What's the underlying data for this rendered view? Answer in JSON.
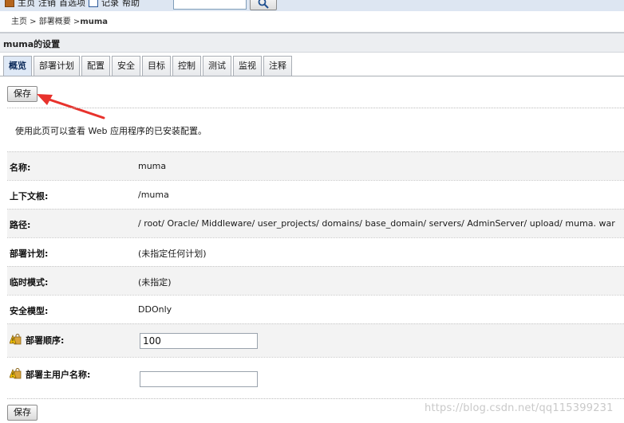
{
  "toolbar": {
    "home": "主页",
    "logout": "注销",
    "preferences": "首选项",
    "record": "记录",
    "help": "帮助",
    "search_value": ""
  },
  "breadcrumb": {
    "home": "主页 >",
    "deployments": "部署概要 >",
    "current": "muma"
  },
  "page": {
    "title": "muma的设置",
    "tabs": [
      "概览",
      "部署计划",
      "配置",
      "安全",
      "目标",
      "控制",
      "测试",
      "监视",
      "注释"
    ],
    "active_tab": 0,
    "save_label": "保存",
    "intro": "使用此页可以查看 Web 应用程序的已安装配置。"
  },
  "settings": [
    {
      "label": "名称:",
      "value": "muma"
    },
    {
      "label": "上下文根:",
      "value": "/muma"
    },
    {
      "label": "路径:",
      "value": "/ root/ Oracle/ Middleware/ user_projects/ domains/ base_domain/ servers/ AdminServer/ upload/ muma. war"
    },
    {
      "label": "部署计划:",
      "value": "(未指定任何计划)"
    },
    {
      "label": "临时模式:",
      "value": "(未指定)"
    },
    {
      "label": "安全模型:",
      "value": "DDOnly"
    },
    {
      "label": "部署顺序:",
      "value": "100"
    },
    {
      "label": "部署主用户名称:",
      "value": ""
    }
  ],
  "watermark": "https://blog.csdn.net/qq115399231",
  "colors": {
    "active_tab_text": "#0b2a5a",
    "toolbar_bg": "#dde6f2",
    "arrow": "#e8322c"
  }
}
